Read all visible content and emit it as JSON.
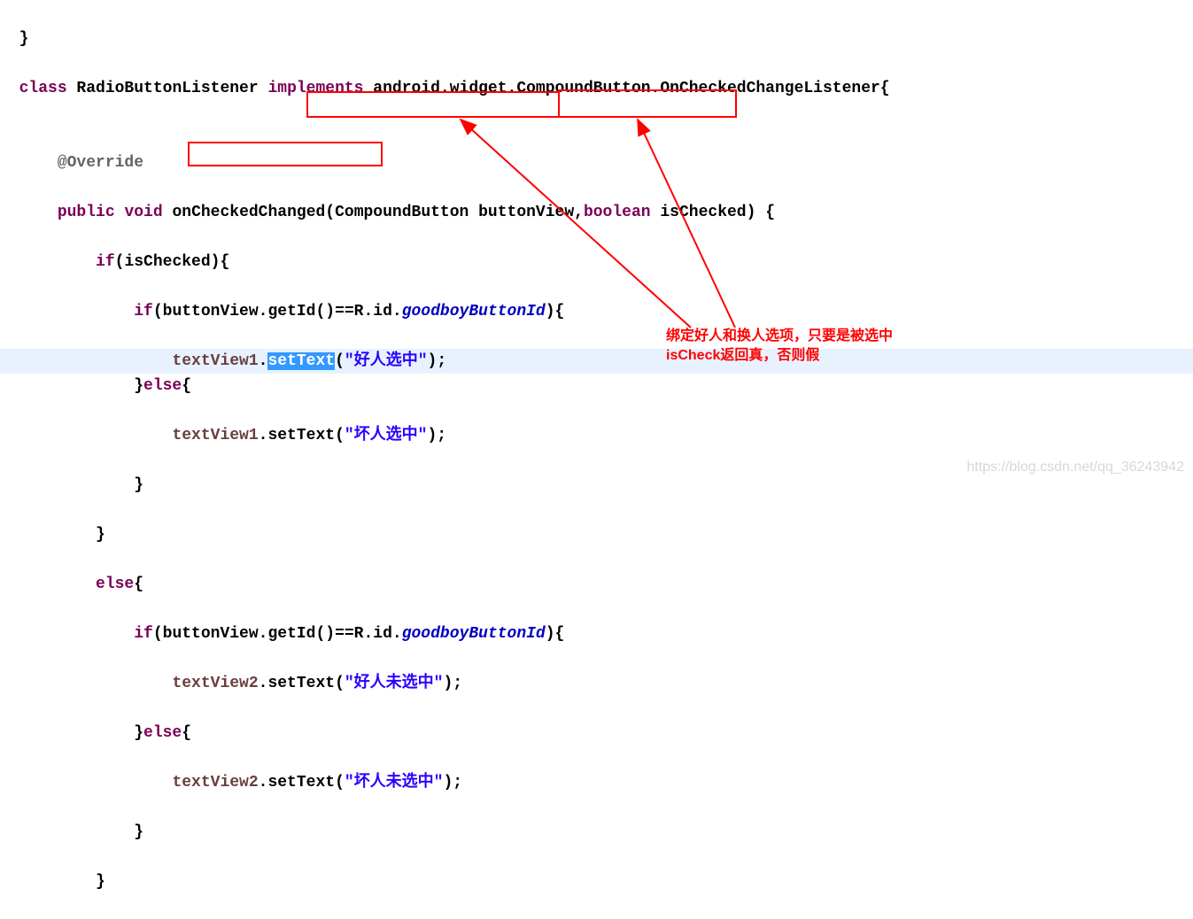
{
  "code": {
    "l0_brace": "  }",
    "l1_p1": "  ",
    "l1_class": "class",
    "l1_p2": " RadioButtonListener ",
    "l1_impl": "implements",
    "l1_p3": " android.widget.CompoundButton.OnCheckedChangeListener{",
    "blank": "",
    "l3_override": "      @Override",
    "l4_p1": "      ",
    "l4_public": "public",
    "l4_sp": " ",
    "l4_void": "void",
    "l4_p2": " ",
    "l4_method": "onCheckedChanged",
    "l4_p3": "(CompoundButton buttonView,",
    "l4_bool": "boolean",
    "l4_p4": " isChecked) {",
    "l5_p1": "          ",
    "l5_if": "if",
    "l5_p2": "(isChecked){",
    "l6_p1": "              ",
    "l6_if": "if",
    "l6_p2": "(buttonView.getId()==R.id.",
    "l6_goodboy": "goodboyButtonId",
    "l6_p3": "){",
    "l7_p1": "                  ",
    "l7_tv": "textView1",
    "l7_dot": ".",
    "l7_settext": "setText",
    "l7_p2": "(",
    "l7_str": "\"好人选中\"",
    "l7_p3": ");",
    "l8_p1": "              }",
    "l8_else": "else",
    "l8_p2": "{",
    "l9_p1": "                  ",
    "l9_tv": "textView1",
    "l9_p2": ".setText(",
    "l9_str": "\"坏人选中\"",
    "l9_p3": ");",
    "l10": "              }",
    "l11": "          }",
    "l12_p1": "          ",
    "l12_else": "else",
    "l12_p2": "{",
    "l13_p1": "              ",
    "l13_if": "if",
    "l13_p2": "(buttonView.getId()==R.id.",
    "l13_goodboy": "goodboyButtonId",
    "l13_p3": "){",
    "l14_p1": "                  ",
    "l14_tv": "textView2",
    "l14_p2": ".setText(",
    "l14_str": "\"好人未选中\"",
    "l14_p3": ");",
    "l15_p1": "              }",
    "l15_else": "else",
    "l15_p2": "{",
    "l16_p1": "                  ",
    "l16_tv": "textView2",
    "l16_p2": ".setText(",
    "l16_str": "\"坏人未选中\"",
    "l16_p3": ");",
    "l17": "              }",
    "l18": "          }"
  },
  "annotation": {
    "line1": "绑定好人和换人选项，只要是被选中",
    "line2": "isCheck返回真，否则假"
  },
  "watermark": "https://blog.csdn.net/qq_36243942"
}
